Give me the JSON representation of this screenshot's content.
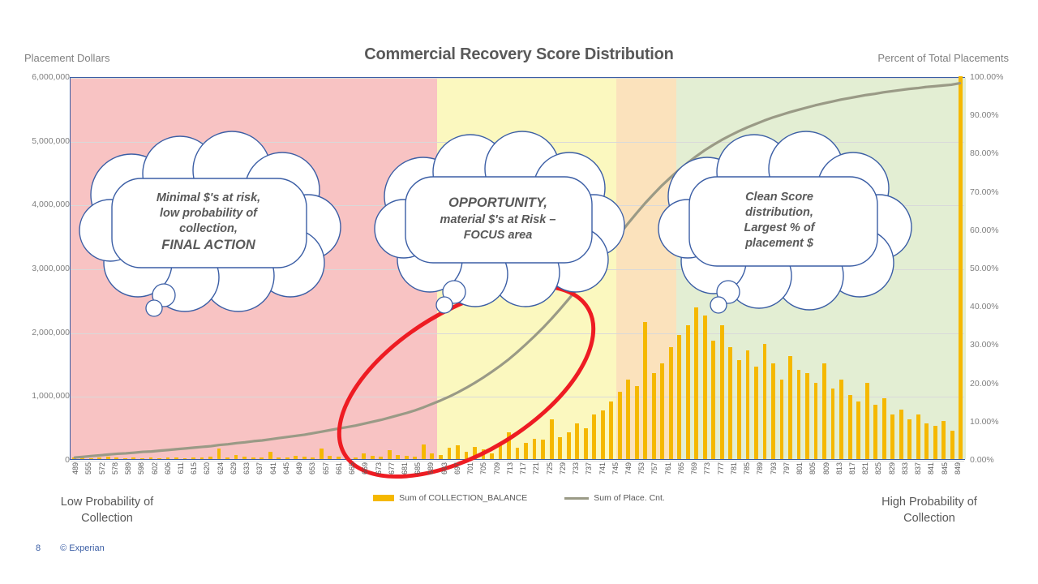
{
  "slide": {
    "footer_page": "8",
    "footer_copyright": "© Experian",
    "accent_blue": "#3b5ea5",
    "bar_color": "#f5b800",
    "line_color": "#9a9a86",
    "ellipse_color": "#ee1c23"
  },
  "header": {
    "title": "Commercial Recovery Score Distribution",
    "left_axis_title": "Placement Dollars",
    "right_axis_title": "Percent of Total Placements"
  },
  "captions": {
    "left_line1": "Low Probability of",
    "left_line2": "Collection",
    "right_line1": "High Probability of",
    "right_line2": "Collection"
  },
  "legend": [
    {
      "label": "Sum of COLLECTION_BALANCE",
      "marker": "bar",
      "color": "#f5b800"
    },
    {
      "label": "Sum of Place. Cnt.",
      "marker": "line",
      "color": "#9a9a86"
    }
  ],
  "callouts": [
    {
      "name": "callout-final-action",
      "lines": [
        "Minimal $'s at risk,",
        "low probability of",
        "collection,",
        "FINAL ACTION"
      ],
      "emphasis": [
        false,
        false,
        false,
        true
      ]
    },
    {
      "name": "callout-opportunity",
      "lines": [
        "OPPORTUNITY,",
        "material $'s at Risk –",
        "FOCUS area"
      ],
      "emphasis": [
        true,
        false,
        false
      ]
    },
    {
      "name": "callout-clean-score",
      "lines": [
        "Clean Score",
        "distribution,",
        "Largest % of",
        "placement $"
      ],
      "emphasis": [
        false,
        false,
        false,
        false
      ]
    }
  ],
  "bands": [
    {
      "name": "final-action-zone",
      "color": "#f8c3c3",
      "from_index": 0,
      "to_index": 43
    },
    {
      "name": "opportunity-zone",
      "color": "#fbf8bf",
      "from_index": 43,
      "to_index": 64
    },
    {
      "name": "transition-zone",
      "color": "#fbe2bc",
      "from_index": 64,
      "to_index": 71
    },
    {
      "name": "clean-zone",
      "color": "#e3eed3",
      "from_index": 71,
      "to_index": 105
    }
  ],
  "chart_data": {
    "type": "bar",
    "title": "Commercial Recovery Score Distribution",
    "subtitle": "",
    "xlabel": "",
    "ylabel": "Placement Dollars",
    "y2label": "Percent of Total Placements",
    "ylim": [
      0,
      6000000
    ],
    "y2lim": [
      0,
      1.0
    ],
    "yticks": [
      "0",
      "1,000,000",
      "2,000,000",
      "3,000,000",
      "4,000,000",
      "5,000,000",
      "6,000,000"
    ],
    "y2ticks": [
      "0.00%",
      "10.00%",
      "20.00%",
      "30.00%",
      "40.00%",
      "50.00%",
      "60.00%",
      "70.00%",
      "80.00%",
      "90.00%",
      "100.00%"
    ],
    "grid": true,
    "legend_position": "bottom",
    "xtick_labels": [
      "489",
      "555",
      "572",
      "578",
      "589",
      "598",
      "602",
      "606",
      "611",
      "615",
      "620",
      "624",
      "629",
      "633",
      "637",
      "641",
      "645",
      "649",
      "653",
      "657",
      "661",
      "665",
      "669",
      "673",
      "677",
      "681",
      "685",
      "689",
      "693",
      "697",
      "701",
      "705",
      "709",
      "713",
      "717",
      "721",
      "725",
      "729",
      "733",
      "737",
      "741",
      "745",
      "749",
      "753",
      "757",
      "761",
      "765",
      "769",
      "773",
      "777",
      "781",
      "785",
      "789",
      "793",
      "797",
      "801",
      "805",
      "809",
      "813",
      "817",
      "821",
      "825",
      "829",
      "833",
      "837",
      "841",
      "845",
      "849"
    ],
    "xtick_every": 1,
    "series": [
      {
        "name": "Sum of COLLECTION_BALANCE",
        "type": "bar",
        "axis": "left",
        "color": "#f5b800",
        "values": [
          30000,
          22000,
          18000,
          26000,
          40000,
          21000,
          16000,
          25000,
          19000,
          24000,
          18000,
          30000,
          22000,
          17000,
          26000,
          20000,
          36000,
          160000,
          24000,
          60000,
          42000,
          28000,
          22000,
          120000,
          30000,
          26000,
          45000,
          34000,
          28000,
          170000,
          52000,
          40000,
          34000,
          26000,
          90000,
          48000,
          38000,
          140000,
          70000,
          46000,
          38000,
          230000,
          95000,
          60000,
          175000,
          210000,
          120000,
          190000,
          150000,
          95000,
          230000,
          420000,
          180000,
          260000,
          320000,
          300000,
          620000,
          340000,
          420000,
          560000,
          480000,
          700000,
          760000,
          900000,
          1050000,
          1250000,
          1150000,
          2150000,
          1350000,
          1500000,
          1750000,
          1950000,
          2100000,
          2380000,
          2250000,
          1850000,
          2100000,
          1750000,
          1550000,
          1700000,
          1450000,
          1800000,
          1500000,
          1250000,
          1620000,
          1400000,
          1350000,
          1200000,
          1500000,
          1100000,
          1250000,
          1000000,
          900000,
          1200000,
          850000,
          950000,
          700000,
          780000,
          620000,
          700000,
          560000,
          520000,
          600000,
          450000,
          6000000
        ],
        "note": "Final bar at right edge is a tall partial column hugging the plot border"
      },
      {
        "name": "Sum of Place. Cnt.",
        "type": "line",
        "axis": "right",
        "color": "#9a9a86",
        "values_percent": [
          0.4,
          0.6,
          0.8,
          1.0,
          1.2,
          1.4,
          1.5,
          1.7,
          1.9,
          2.0,
          2.2,
          2.4,
          2.6,
          2.8,
          3.0,
          3.2,
          3.4,
          3.7,
          3.9,
          4.2,
          4.4,
          4.7,
          4.9,
          5.2,
          5.5,
          5.8,
          6.1,
          6.4,
          6.8,
          7.2,
          7.6,
          8.0,
          8.4,
          8.8,
          9.3,
          9.8,
          10.3,
          10.9,
          11.5,
          12.1,
          12.8,
          13.6,
          14.5,
          15.4,
          16.4,
          17.5,
          18.7,
          20.0,
          21.4,
          22.9,
          24.5,
          26.2,
          28.1,
          30.1,
          32.2,
          34.4,
          36.8,
          39.3,
          41.9,
          44.6,
          47.4,
          50.3,
          53.2,
          56.1,
          59.0,
          61.8,
          64.5,
          67.1,
          69.5,
          71.8,
          73.9,
          75.9,
          77.7,
          79.4,
          81.0,
          82.4,
          83.7,
          84.9,
          86.0,
          87.0,
          87.9,
          88.8,
          89.6,
          90.3,
          91.0,
          91.6,
          92.2,
          92.8,
          93.3,
          93.8,
          94.3,
          94.7,
          95.1,
          95.5,
          95.8,
          96.2,
          96.5,
          96.8,
          97.1,
          97.3,
          97.6,
          97.8,
          98.0,
          98.2,
          98.6
        ]
      }
    ],
    "annotations": [
      {
        "name": "red-ellipse-highlight",
        "shape": "ellipse",
        "color": "#ee1c23",
        "describes": "Opportunity region spanning mid-score bars"
      },
      {
        "name": "callout-final-action",
        "text": "Minimal $'s at risk, low probability of collection, FINAL ACTION"
      },
      {
        "name": "callout-opportunity",
        "text": "OPPORTUNITY, material $'s at Risk – FOCUS area"
      },
      {
        "name": "callout-clean-score",
        "text": "Clean Score distribution, Largest % of placement $"
      }
    ]
  }
}
